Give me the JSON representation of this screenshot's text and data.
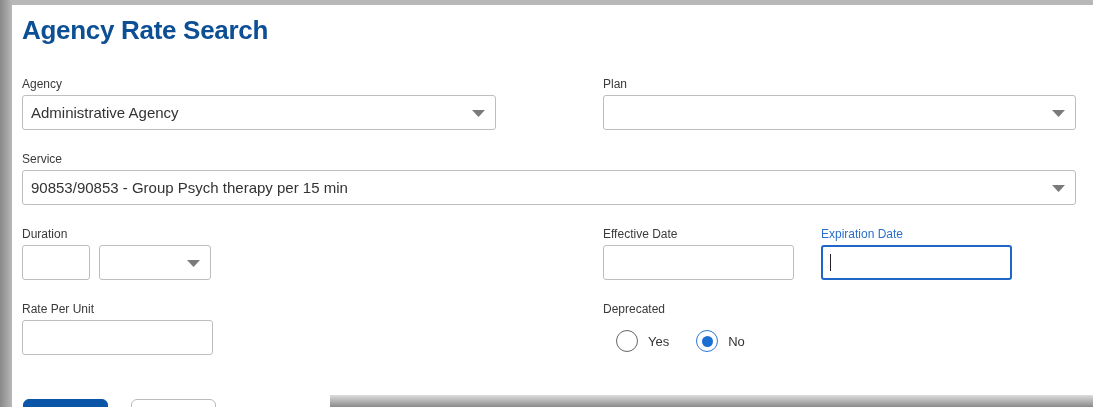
{
  "title": "Agency Rate Search",
  "agency": {
    "label": "Agency",
    "value": "Administrative Agency"
  },
  "plan": {
    "label": "Plan"
  },
  "service": {
    "label": "Service",
    "value": "90853/90853 - Group Psych therapy per 15 min"
  },
  "duration": {
    "label": "Duration"
  },
  "effective_date": {
    "label": "Effective Date",
    "focused": false
  },
  "expiration_date": {
    "label": "Expiration Date",
    "focused": true
  },
  "rate_per_unit": {
    "label": "Rate Per Unit"
  },
  "deprecated": {
    "label": "Deprecated",
    "options": [
      {
        "label": "Yes",
        "selected": false
      },
      {
        "label": "No",
        "selected": true
      }
    ]
  },
  "buttons": [
    {
      "kind": "primary"
    },
    {
      "kind": "secondary"
    }
  ]
}
